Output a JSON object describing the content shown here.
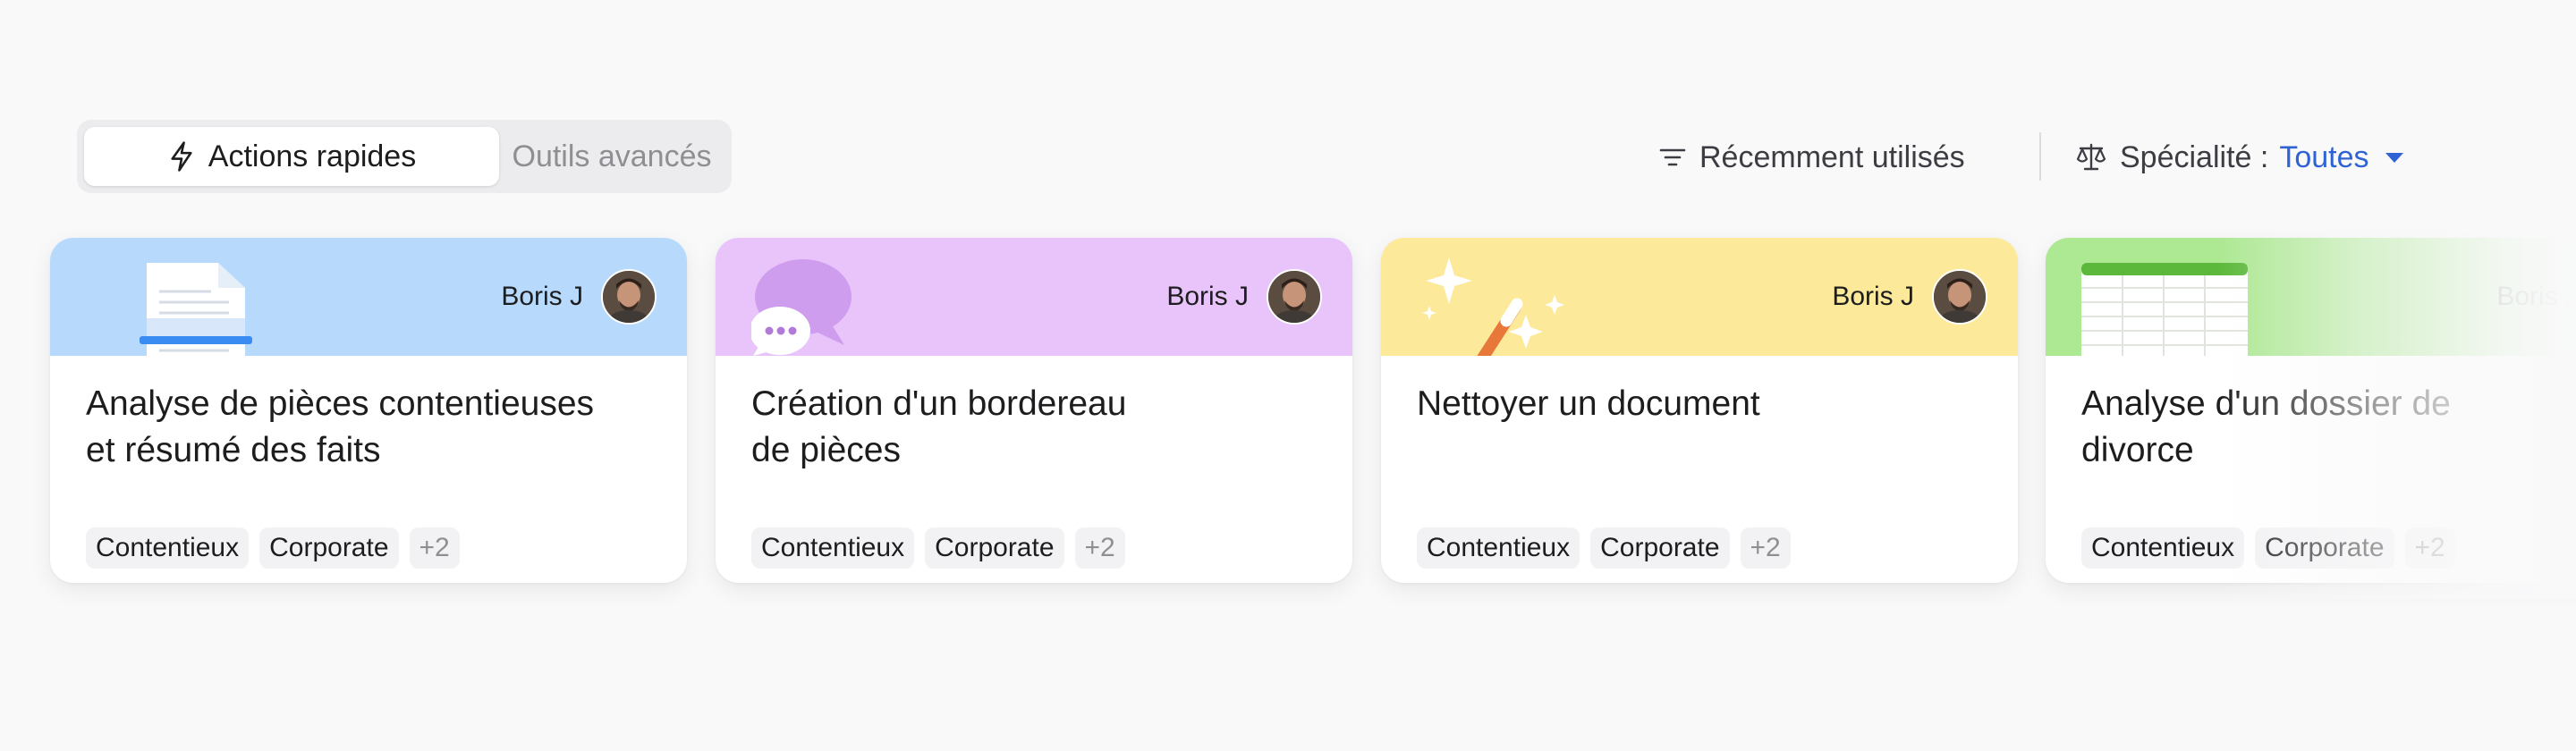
{
  "toolbar": {
    "tabs": [
      {
        "label": "Actions rapides",
        "active": true,
        "icon": "bolt-icon"
      },
      {
        "label": "Outils avancés",
        "active": false
      }
    ],
    "sort": {
      "label": "Récemment utilisés",
      "icon": "filter-lines-icon"
    },
    "specialty": {
      "label": "Spécialité :",
      "value": "Toutes",
      "icon": "scale-icon",
      "caret": "caret-down-icon"
    }
  },
  "colors": {
    "accent": "#2f63d4",
    "card_blue": "#b7dafc",
    "card_purple": "#e8c4fb",
    "card_yellow": "#fde99a",
    "card_green": "#ade893"
  },
  "cards": [
    {
      "author": "Boris J",
      "title_line1": "Analyse de pièces contentieuses",
      "title_line2": "et résumé des faits",
      "tags": [
        "Contentieux",
        "Corporate"
      ],
      "more": "+2",
      "header_color": "#b7dafc",
      "illustration": "document-scan-icon"
    },
    {
      "author": "Boris J",
      "title_line1": "Création d'un bordereau",
      "title_line2": "de pièces",
      "tags": [
        "Contentieux",
        "Corporate"
      ],
      "more": "+2",
      "header_color": "#e8c4fb",
      "illustration": "chat-bubbles-icon"
    },
    {
      "author": "Boris J",
      "title_line1": "Nettoyer un document",
      "title_line2": "",
      "tags": [
        "Contentieux",
        "Corporate"
      ],
      "more": "+2",
      "header_color": "#fde99a",
      "illustration": "magic-wand-icon"
    },
    {
      "author": "Boris J",
      "title_line1": "Analyse d'un dossier de",
      "title_line2": "divorce",
      "tags": [
        "Contentieux",
        "Corporate"
      ],
      "more": "+2",
      "header_color": "#ade893",
      "illustration": "spreadsheet-icon"
    }
  ]
}
